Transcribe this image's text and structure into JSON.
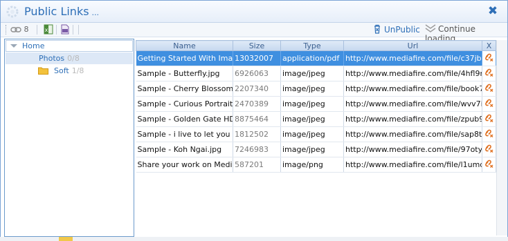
{
  "window": {
    "title": "Public Links",
    "title_suffix": "...",
    "close_glyph": "✖",
    "accent": "#2e6fb7"
  },
  "toolbar": {
    "link_count": "8",
    "unpublic_label": "UnPublic",
    "continue_label": "Continue loading",
    "icons": [
      "link-icon",
      "excel-export-icon",
      "csv-export-icon",
      "unpublic-icon",
      "continue-icon"
    ]
  },
  "tree": {
    "root_label": "Home",
    "items": [
      {
        "label": "Photos",
        "count": "0/8"
      },
      {
        "label": "Soft",
        "count": "1/8"
      }
    ]
  },
  "grid": {
    "columns": [
      "Name",
      "Size",
      "Type",
      "Url",
      "X"
    ],
    "rows": [
      {
        "name": "Getting Started With Ima...",
        "size": "13032007",
        "type": "application/pdf",
        "url": "http://www.mediafire.com/file/c37jb..."
      },
      {
        "name": "Sample - Butterfly.jpg",
        "size": "6926063",
        "type": "image/jpeg",
        "url": "http://www.mediafire.com/file/4hfl9r..."
      },
      {
        "name": "Sample - Cherry Blossom...",
        "size": "2207340",
        "type": "image/jpeg",
        "url": "http://www.mediafire.com/file/book7..."
      },
      {
        "name": "Sample - Curious Portrait...",
        "size": "2470389",
        "type": "image/jpeg",
        "url": "http://www.mediafire.com/file/wvv7i..."
      },
      {
        "name": "Sample - Golden Gate HD...",
        "size": "8875464",
        "type": "image/jpeg",
        "url": "http://www.mediafire.com/file/zpub9..."
      },
      {
        "name": "Sample - i live to let you ...",
        "size": "1812502",
        "type": "image/jpeg",
        "url": "http://www.mediafire.com/file/sap8t..."
      },
      {
        "name": "Sample - Koh Ngai.jpg",
        "size": "7246983",
        "type": "image/jpeg",
        "url": "http://www.mediafire.com/file/97oty..."
      },
      {
        "name": "Share your work on Medi...",
        "size": "587201",
        "type": "image/png",
        "url": "http://www.mediafire.com/file/l1umd..."
      }
    ]
  }
}
